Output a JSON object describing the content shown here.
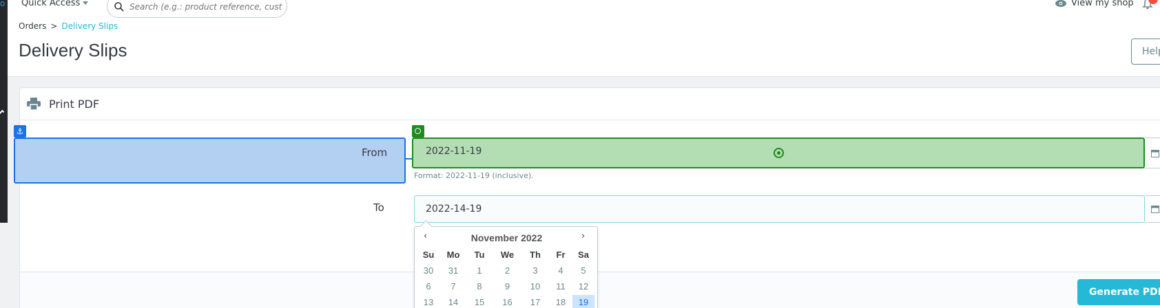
{
  "nav": {
    "quick_access_label": "Quick Access",
    "search_placeholder": "Search (e.g.: product reference, custon",
    "view_shop_label": "View my shop"
  },
  "breadcrumb": {
    "parent": "Orders",
    "separator": ">",
    "current": "Delivery Slips"
  },
  "page": {
    "title": "Delivery Slips",
    "help_label": "Help"
  },
  "panel": {
    "title": "Print PDF",
    "icon": "printer-icon"
  },
  "form": {
    "from_label": "From",
    "from_value": "2022-11-19",
    "from_help": "Format: 2022-11-19 (inclusive).",
    "to_label": "To",
    "to_value": "2022-14-19"
  },
  "datepicker": {
    "prev": "‹",
    "next": "›",
    "title": "November 2022",
    "weekdays": [
      "Su",
      "Mo",
      "Tu",
      "We",
      "Th",
      "Fr",
      "Sa"
    ],
    "weeks": [
      [
        "30",
        "31",
        "1",
        "2",
        "3",
        "4",
        "5"
      ],
      [
        "6",
        "7",
        "8",
        "9",
        "10",
        "11",
        "12"
      ],
      [
        "13",
        "14",
        "15",
        "16",
        "17",
        "18",
        "19"
      ]
    ],
    "selected": "19"
  },
  "actions": {
    "generate_label": "Generate PDF"
  },
  "colors": {
    "accent": "#25b9d7",
    "from_highlight": "#b3cff2",
    "target_highlight": "#b3ddb3"
  }
}
